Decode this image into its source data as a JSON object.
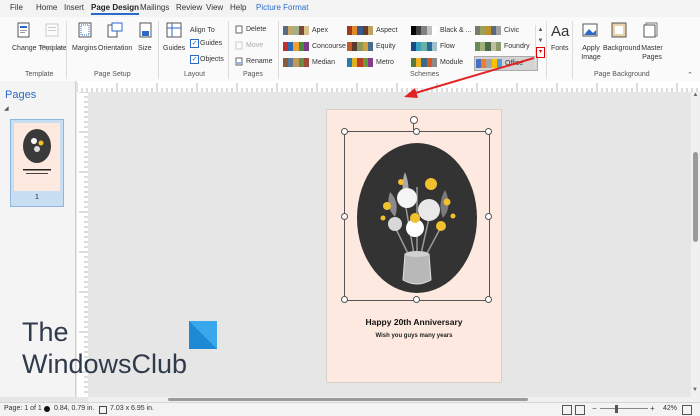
{
  "tabs": [
    "File",
    "Home",
    "Insert",
    "Page Design",
    "Mailings",
    "Review",
    "View",
    "Help",
    "Picture Format"
  ],
  "ribbon": {
    "template": {
      "change_template": "Change Template",
      "options": "Options",
      "group": "Template"
    },
    "page_setup": {
      "margins": "Margins",
      "orientation": "Orientation",
      "size": "Size",
      "group": "Page Setup"
    },
    "layout": {
      "guides": "Guides",
      "align_to": "Align To",
      "guides_check": "Guides",
      "objects_check": "Objects",
      "group": "Layout"
    },
    "pages": {
      "delete": "Delete",
      "move": "Move",
      "rename": "Rename",
      "group": "Pages"
    },
    "schemes": {
      "group": "Schemes",
      "items": [
        {
          "name": "Apex",
          "colors": [
            "#5b6b7e",
            "#c7a86c",
            "#a0b08a",
            "#7a4a3a",
            "#d7c28a"
          ]
        },
        {
          "name": "Concourse",
          "colors": [
            "#c0302a",
            "#2a6ab0",
            "#f0a030",
            "#4a8a3a",
            "#7a3a8a"
          ]
        },
        {
          "name": "Median",
          "colors": [
            "#8a5a3a",
            "#5a7a9a",
            "#c09a5a",
            "#6a8a4a",
            "#a04a3a"
          ]
        },
        {
          "name": "Aspect",
          "colors": [
            "#a03a1a",
            "#e08a2a",
            "#3a5a8a",
            "#6a3a2a",
            "#c0a05a"
          ]
        },
        {
          "name": "Equity",
          "colors": [
            "#c05a2a",
            "#5a3a2a",
            "#8a9a5a",
            "#d0a040",
            "#4a6a8a"
          ]
        },
        {
          "name": "Metro",
          "colors": [
            "#2a7ab0",
            "#e0b020",
            "#c03a2a",
            "#6a9a3a",
            "#8a3a8a"
          ]
        },
        {
          "name": "Black & ...",
          "colors": [
            "#000000",
            "#404040",
            "#808080",
            "#c0c0c0",
            "#ffffff"
          ]
        },
        {
          "name": "Flow",
          "colors": [
            "#1a4a8a",
            "#3aa0c0",
            "#6ab0a0",
            "#2a6a9a",
            "#a0c0d0"
          ]
        },
        {
          "name": "Module",
          "colors": [
            "#5a7a3a",
            "#f0b020",
            "#3a6a8a",
            "#d05a2a",
            "#8a8a8a"
          ]
        },
        {
          "name": "Civic",
          "colors": [
            "#7a7a6a",
            "#9aa05a",
            "#c0902a",
            "#5a6a7a",
            "#a0a0a0"
          ]
        },
        {
          "name": "Foundry",
          "colors": [
            "#6a8a5a",
            "#a0b07a",
            "#4a6a4a",
            "#c0c0a0",
            "#8a9a6a"
          ]
        },
        {
          "name": "Office",
          "colors": [
            "#4472c4",
            "#ed7d31",
            "#a5a5a5",
            "#ffc000",
            "#5b9bd5"
          ]
        }
      ]
    },
    "fonts": "Fonts",
    "background": {
      "apply_image": "Apply Image",
      "background": "Background",
      "master_pages": "Master Pages",
      "group": "Page Background"
    }
  },
  "pages_pane": {
    "title": "Pages",
    "page_number": "1"
  },
  "page": {
    "line1": "Happy 20th Anniversary",
    "line2": "Wish you guys many years"
  },
  "watermark": {
    "line1": "The",
    "line2": "WindowsClub"
  },
  "status": {
    "page": "Page: 1 of 1",
    "position": "0.84, 0.79 in.",
    "size": "7.03 x 6.95 in.",
    "zoom": "42%"
  },
  "colors": {
    "accent": "#2b6ac8",
    "page_bg": "#fde9df",
    "arrow": "#e02424"
  }
}
